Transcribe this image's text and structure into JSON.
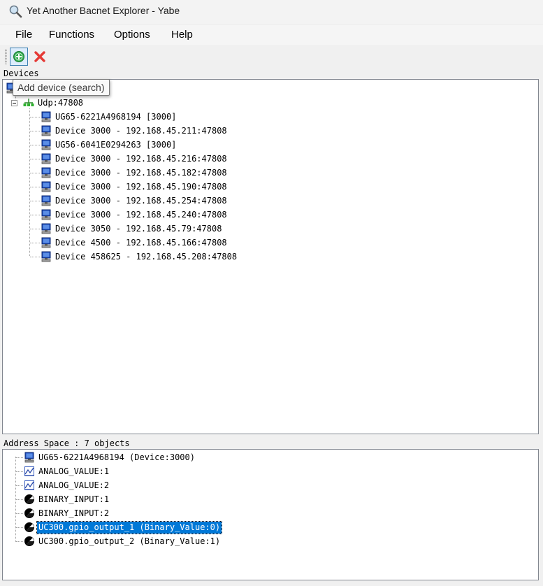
{
  "window": {
    "title": "Yet Another Bacnet Explorer - Yabe"
  },
  "menu": {
    "items": [
      "File",
      "Functions",
      "Options",
      "Help"
    ]
  },
  "toolbar": {
    "add_tooltip": "Add device (search)"
  },
  "devices": {
    "label": "Devices",
    "network": "Udp:47808",
    "items": [
      "UG65-6221A4968194 [3000]",
      "Device 3000 - 192.168.45.211:47808",
      "UG56-6041E0294263 [3000]",
      "Device 3000 - 192.168.45.216:47808",
      "Device 3000 - 192.168.45.182:47808",
      "Device 3000 - 192.168.45.190:47808",
      "Device 3000 - 192.168.45.254:47808",
      "Device 3000 - 192.168.45.240:47808",
      "Device 3050 - 192.168.45.79:47808",
      "Device 4500 - 192.168.45.166:47808",
      "Device 458625 - 192.168.45.208:47808"
    ]
  },
  "address_space": {
    "label": "Address Space : 7 objects",
    "items": [
      {
        "label": "UG65-6221A4968194 (Device:3000)",
        "icon": "device-icon"
      },
      {
        "label": "ANALOG_VALUE:1",
        "icon": "analog-value-icon"
      },
      {
        "label": "ANALOG_VALUE:2",
        "icon": "analog-value-icon"
      },
      {
        "label": "BINARY_INPUT:1",
        "icon": "binary-icon"
      },
      {
        "label": "BINARY_INPUT:2",
        "icon": "binary-icon"
      },
      {
        "label": "UC300.gpio_output_1 (Binary_Value:0)",
        "icon": "binary-icon",
        "selected": true
      },
      {
        "label": "UC300.gpio_output_2 (Binary_Value:1)",
        "icon": "binary-icon"
      }
    ]
  },
  "colors": {
    "selection": "#0078d7",
    "panel_border": "#828790",
    "add_button": "#2da84a",
    "delete_button": "#e53935"
  }
}
